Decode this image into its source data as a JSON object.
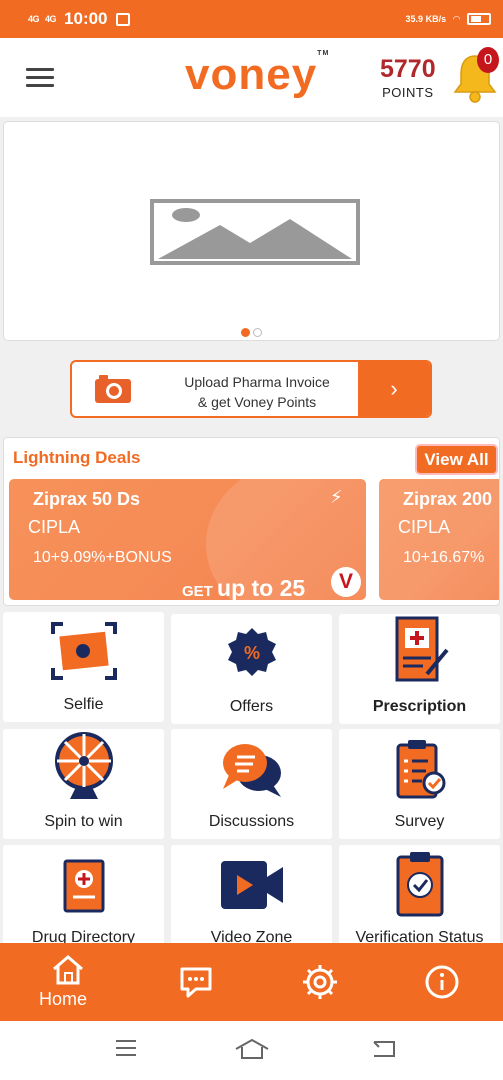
{
  "status_bar": {
    "network_1": "4G",
    "network_2": "4G",
    "time": "10:00",
    "net_speed": "35.9 KB/s",
    "battery_level": "41"
  },
  "header": {
    "logo_text": "voney",
    "logo_tm": "TM",
    "points_value": "5770",
    "points_label": "POINTS",
    "notification_count": "0"
  },
  "banner": {
    "image": "image-placeholder-icon",
    "pages": 2,
    "active_page": 1
  },
  "upload": {
    "line1": "Upload Pharma Invoice",
    "line2": "& get Voney Points",
    "arrow": "›"
  },
  "deals": {
    "title": "Lightning Deals",
    "view_all": "View All",
    "items": [
      {
        "name": "Ziprax 50 Ds",
        "company": "CIPLA",
        "offer": "10+9.09%+BONUS",
        "get_prefix": "GET",
        "get_text": "up to 25"
      },
      {
        "name": "Ziprax 200",
        "company": "CIPLA",
        "offer": "10+16.67%"
      }
    ]
  },
  "tiles": [
    {
      "label": "Selfie",
      "icon": "selfie-icon"
    },
    {
      "label": "Offers",
      "icon": "offers-icon"
    },
    {
      "label": "Prescription",
      "icon": "prescription-icon"
    },
    {
      "label": "Spin to win",
      "icon": "spin-wheel-icon"
    },
    {
      "label": "Discussions",
      "icon": "discussions-icon"
    },
    {
      "label": "Survey",
      "icon": "survey-icon"
    },
    {
      "label": "Drug Directory",
      "icon": "drug-directory-icon"
    },
    {
      "label": "Video Zone",
      "icon": "video-icon"
    },
    {
      "label": "Verification Status",
      "icon": "verification-icon"
    }
  ],
  "bottom_nav": {
    "home": "Home"
  },
  "colors": {
    "accent": "#f26b22",
    "points": "#b0282c",
    "navy": "#1b2a5e"
  }
}
